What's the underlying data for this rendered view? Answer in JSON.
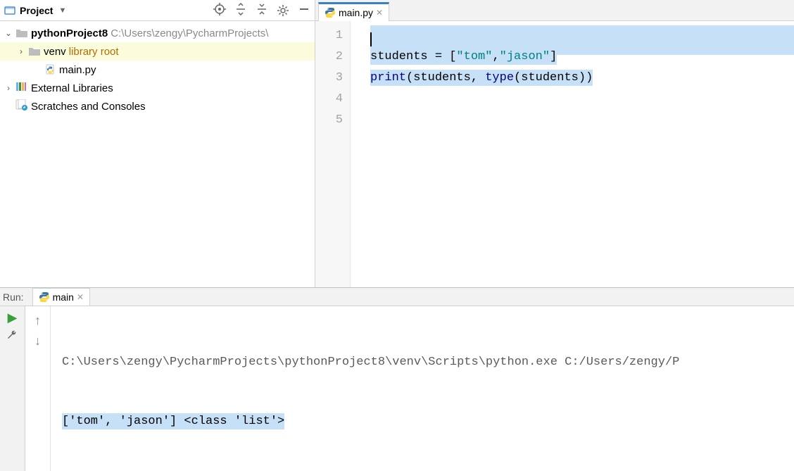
{
  "sidebar": {
    "panel_title": "Project",
    "root": {
      "name": "pythonProject8",
      "path": "C:\\Users\\zengy\\PycharmProjects\\"
    },
    "venv": {
      "name": "venv",
      "note": "library root"
    },
    "file1": "main.py",
    "ext_lib": "External Libraries",
    "scratches": "Scratches and Consoles"
  },
  "editor": {
    "tab_label": "main.py",
    "lines": {
      "l1": "",
      "l2a": "students = [",
      "l2b": "\"tom\"",
      "l2c": ",",
      "l2d": "\"jason\"",
      "l2e": "]",
      "l3a": "print",
      "l3b": "(students, ",
      "l3c": "type",
      "l3d": "(students))"
    },
    "gutter": [
      "1",
      "2",
      "3",
      "4",
      "5"
    ]
  },
  "run": {
    "panel_label": "Run:",
    "tab_label": "main",
    "console_line1": "C:\\Users\\zengy\\PycharmProjects\\pythonProject8\\venv\\Scripts\\python.exe C:/Users/zengy/P",
    "console_line2": "['tom', 'jason'] <class 'list'>"
  }
}
